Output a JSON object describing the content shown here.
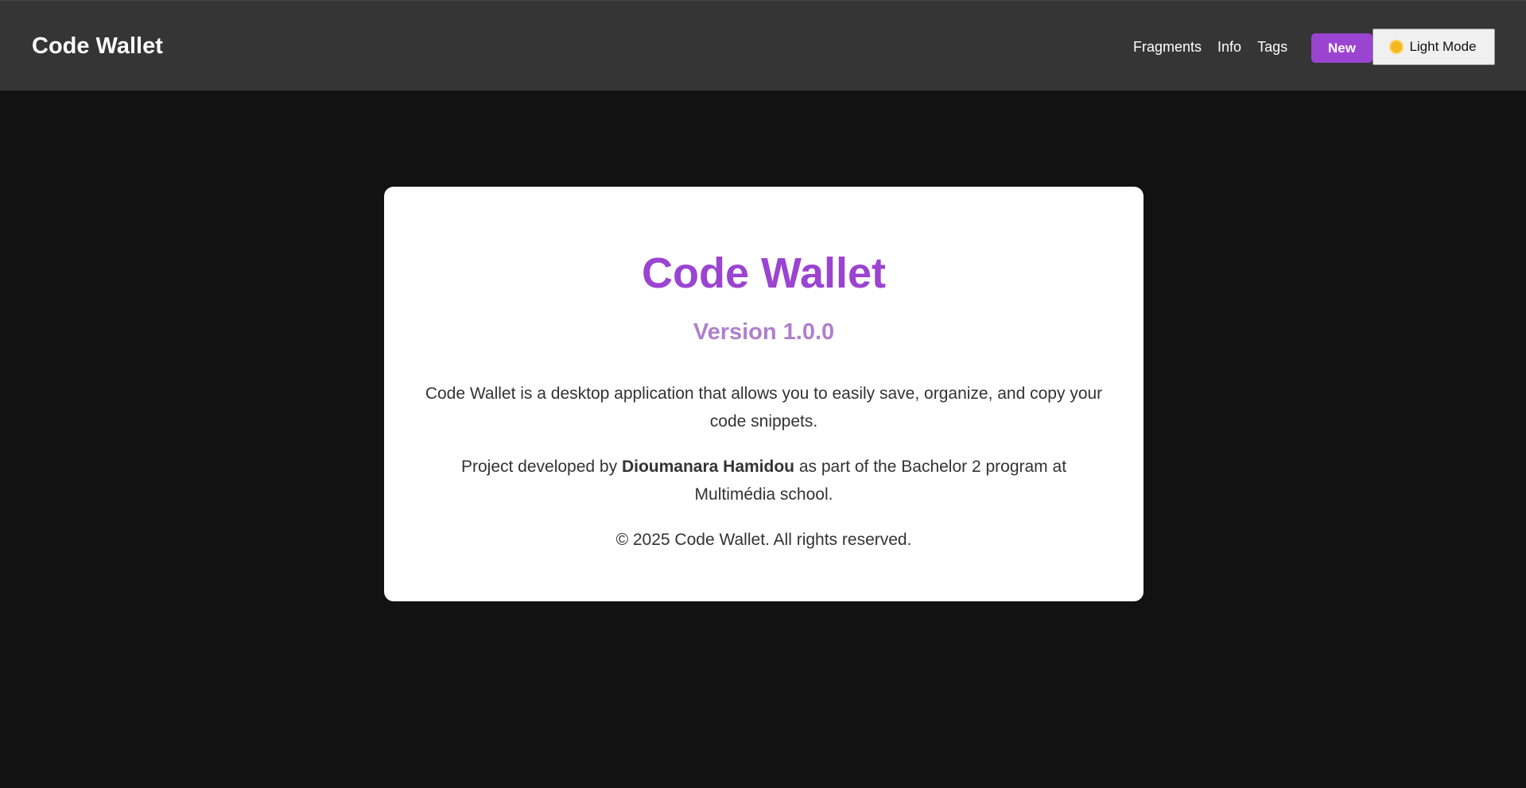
{
  "header": {
    "brand": "Code Wallet",
    "nav": [
      "Fragments",
      "Info",
      "Tags"
    ],
    "new_label": "New",
    "mode_label": "Light Mode",
    "mode_icon": "sun-icon"
  },
  "card": {
    "title": "Code Wallet",
    "version": "Version 1.0.0",
    "description": "Code Wallet is a desktop application that allows you to easily save, organize, and copy your code snippets.",
    "credit_prefix": "Project developed by",
    "credit_author": "Dioumanara Hamidou",
    "credit_suffix": "as part of the Bachelor 2 program at Multimédia school.",
    "copyright": "© 2025 Code Wallet. All rights reserved."
  },
  "colors": {
    "background": "#121212",
    "header": "#353535",
    "accent": "#9b44d1",
    "version": "#b07fcc"
  }
}
